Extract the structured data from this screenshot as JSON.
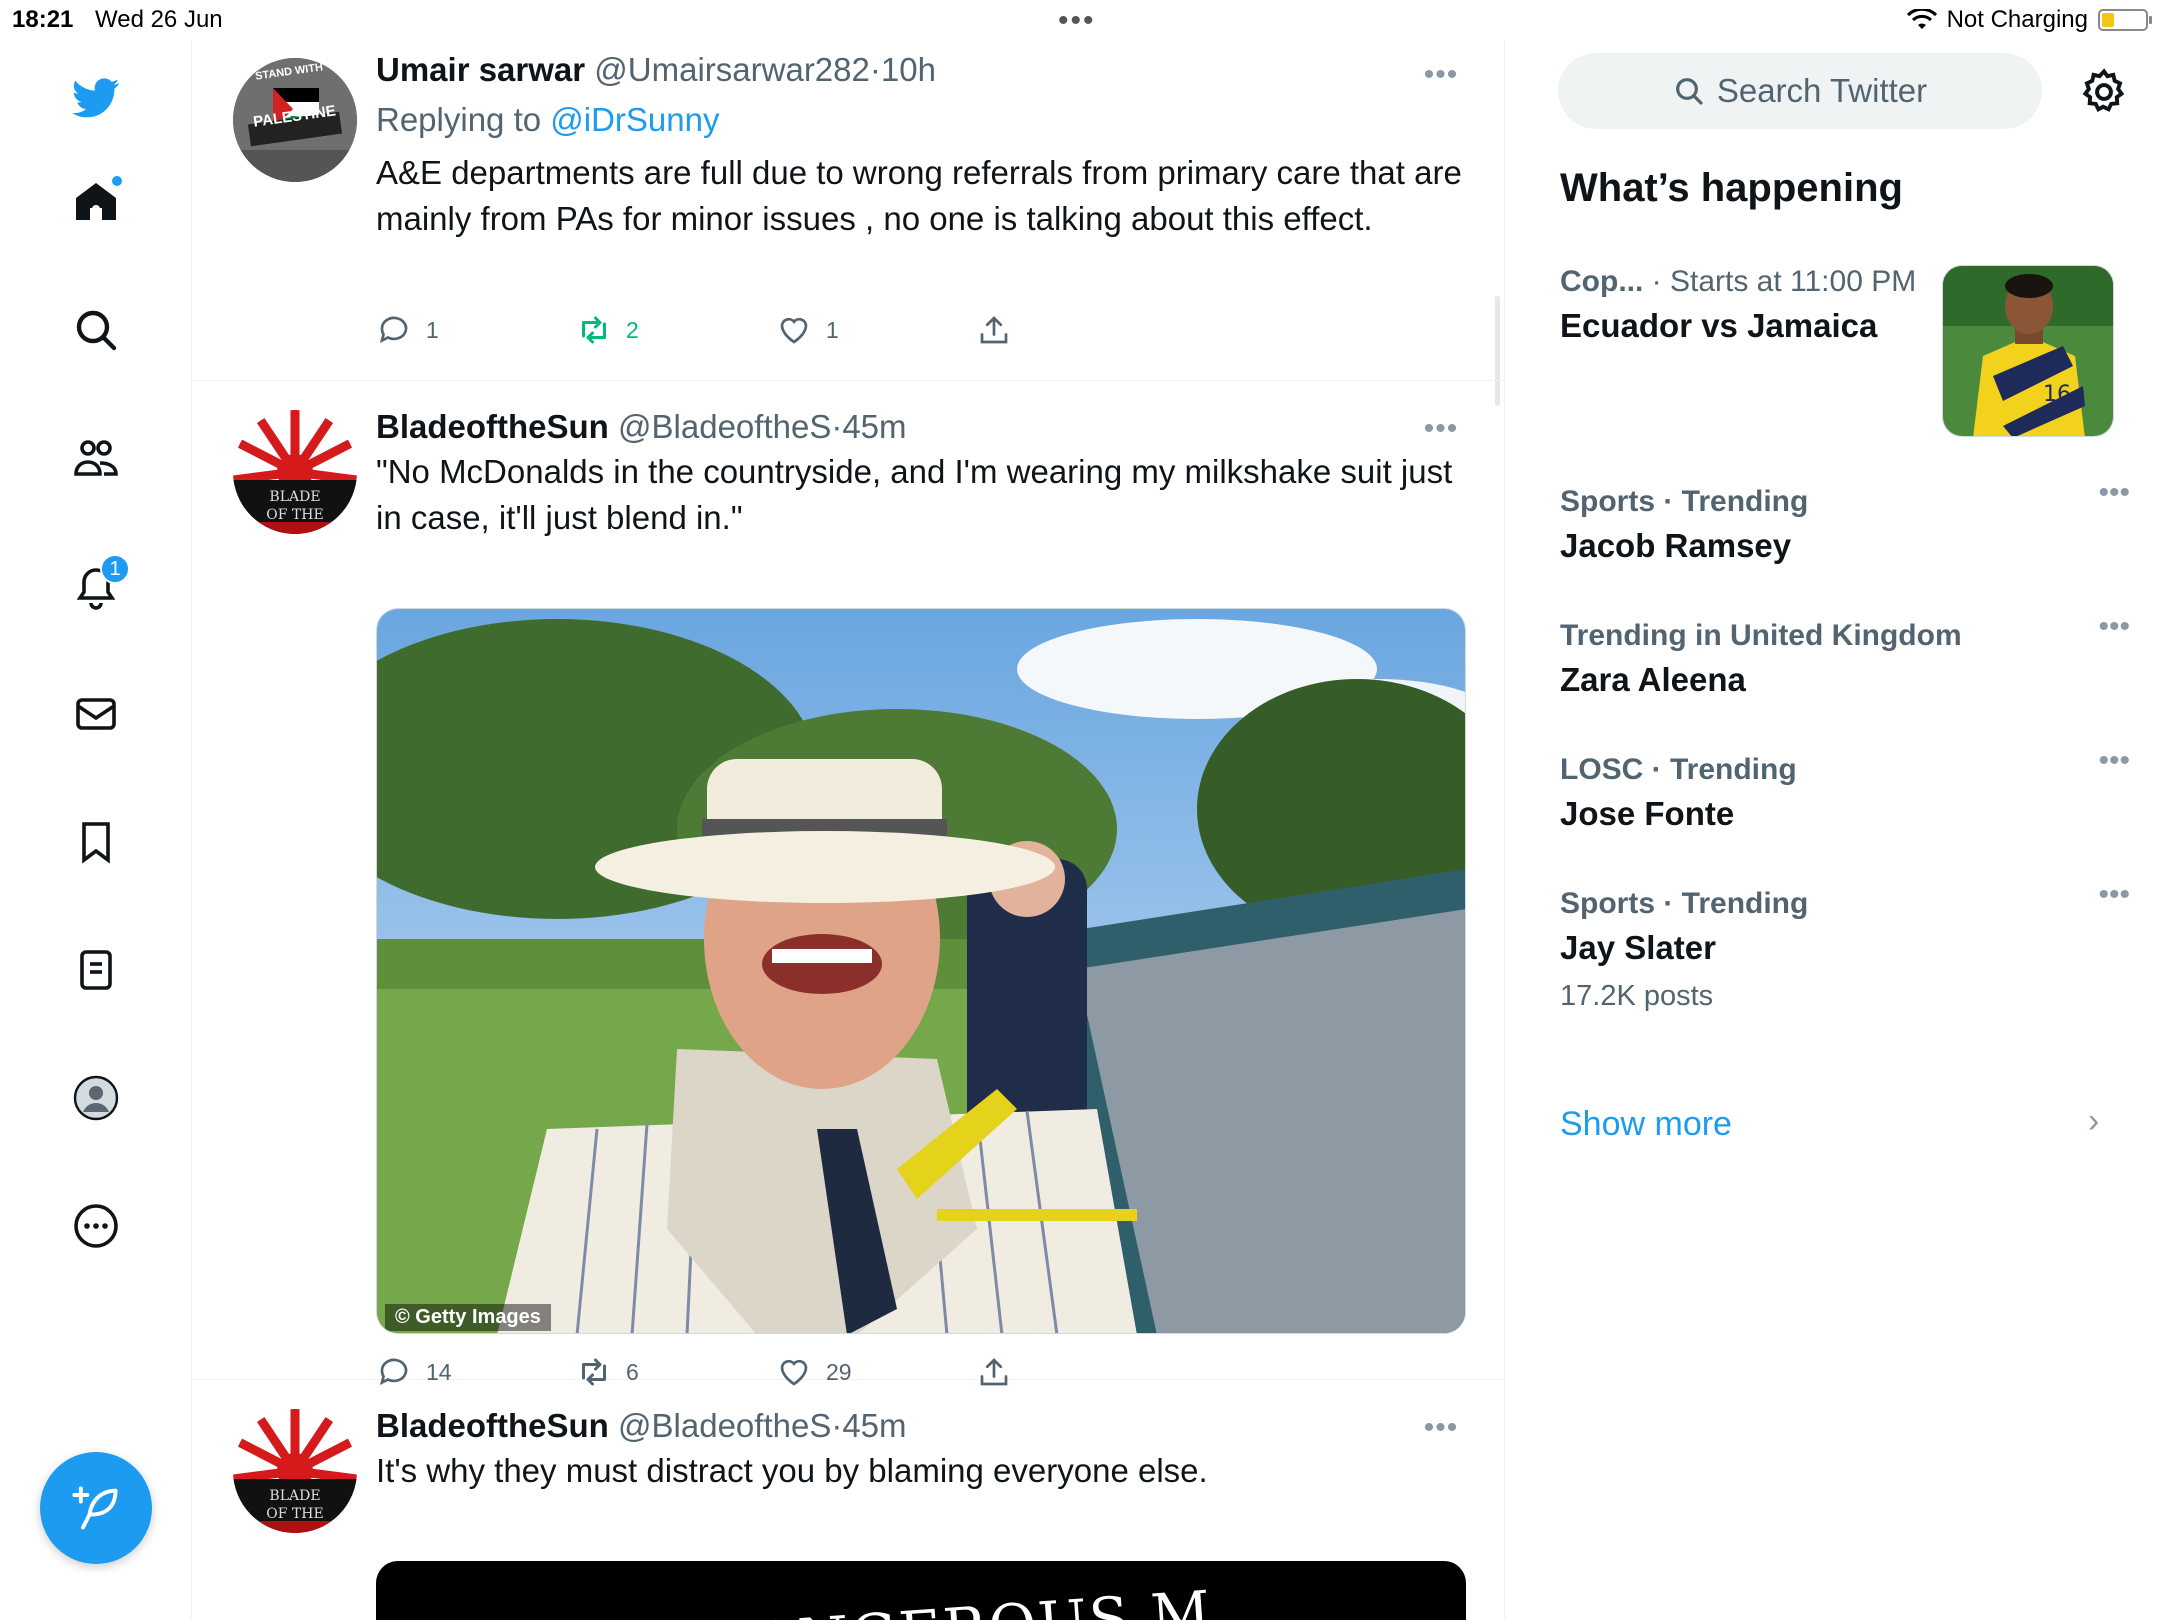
{
  "status_bar": {
    "time": "18:21",
    "date": "Wed 26 Jun",
    "charging": "Not Charging"
  },
  "rail": {
    "notifications_badge": "1"
  },
  "tweets": [
    {
      "name": "Umair sarwar",
      "handle": "@Umairsarwar282",
      "time": "10h",
      "replying_prefix": "Replying to ",
      "replying_to": "@iDrSunny",
      "text": "A&E departments are full due to wrong referrals from primary care that are mainly from PAs for minor issues , no one is talking about this effect.",
      "avatar_text_top": "STAND WITH",
      "avatar_text_bottom": "PALESTINE",
      "replies": "1",
      "retweets": "2",
      "likes": "1"
    },
    {
      "name": "BladeoftheSun",
      "handle": "@BladeoftheS",
      "time": "45m",
      "text": "\"No McDonalds in the countryside, and I'm wearing my milkshake suit just in case, it'll just blend in.\"",
      "avatar_text": "BLADE OF THE",
      "media_credit": "© Getty Images",
      "replies": "14",
      "retweets": "6",
      "likes": "29"
    },
    {
      "name": "BladeoftheSun",
      "handle": "@BladeoftheS",
      "time": "45m",
      "text": "It's why they must distract you by blaming everyone else.",
      "avatar_text": "BLADE OF THE",
      "media_text": "DANGEROUS M"
    }
  ],
  "sidebar": {
    "search_placeholder": "Search Twitter",
    "whats_happening": "What’s happening",
    "trends": [
      {
        "category": "Cop...",
        "category_suffix": " · Starts at 11:00 PM",
        "title": "Ecuador vs Jamaica"
      },
      {
        "category": "Sports · Trending",
        "title": "Jacob Ramsey"
      },
      {
        "category": "Trending in United Kingdom",
        "title": "Zara Aleena"
      },
      {
        "category": "LOSC · Trending",
        "title": "Jose Fonte"
      },
      {
        "category": "Sports · Trending",
        "title": "Jay Slater",
        "posts": "17.2K posts"
      }
    ],
    "show_more": "Show more"
  },
  "colors": {
    "accent": "#1d9bf0",
    "text": "#0f1419",
    "muted": "#536471",
    "retweet_active": "#00ba7c"
  }
}
